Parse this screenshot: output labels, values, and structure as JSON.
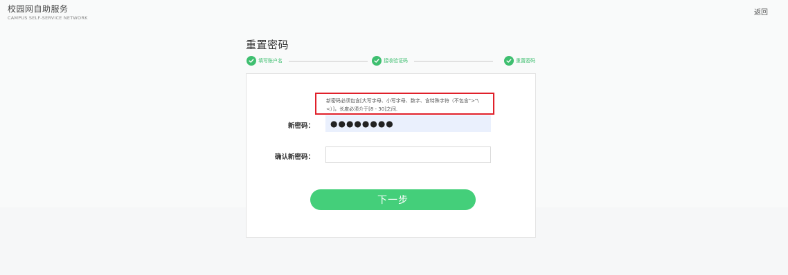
{
  "header": {
    "brand_title": "校园网自助服务",
    "brand_subtitle": "CAMPUS  SELF-SERVICE NETWORK",
    "back_label": "返回"
  },
  "page": {
    "title": "重置密码"
  },
  "steps": [
    {
      "label": "填写账户名",
      "status": "done"
    },
    {
      "label": "接收验证码",
      "status": "done"
    },
    {
      "label": "重置密码",
      "status": "done"
    }
  ],
  "form": {
    "hint_line1": "新密码必须包含[大写字母、小写字母、数字、含特殊字符（不包含\">\"\\",
    "hint_line2": "<）]，长度必须介于[8 - 30]之间.",
    "new_password_label": "新密码：",
    "new_password_value": "●●●●●●●●",
    "confirm_password_label": "确认新密码：",
    "confirm_password_value": "",
    "next_label": "下一步"
  },
  "colors": {
    "accent": "#3fbf70",
    "button": "#44cf7a",
    "hint_border": "#e0202a",
    "autofill": "#eaf0fd"
  }
}
